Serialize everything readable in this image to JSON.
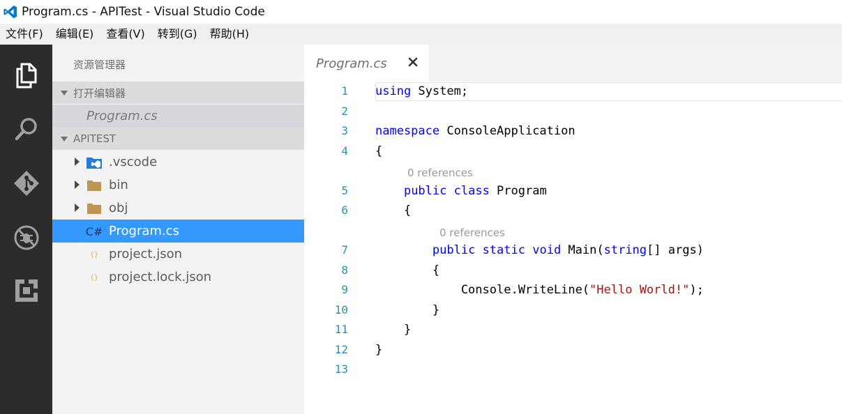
{
  "window": {
    "title": "Program.cs - APITest - Visual Studio Code",
    "logo_icon": "vscode-logo-icon",
    "accent_color": "#007acc"
  },
  "menu": [
    "文件(F)",
    "编辑(E)",
    "查看(V)",
    "转到(G)",
    "帮助(H)"
  ],
  "activity_bar": [
    {
      "name": "explorer-icon",
      "active": true
    },
    {
      "name": "search-icon",
      "active": false
    },
    {
      "name": "git-icon",
      "active": false
    },
    {
      "name": "debug-icon",
      "active": false
    },
    {
      "name": "extensions-icon",
      "active": false
    }
  ],
  "sidebar": {
    "title": "资源管理器",
    "open_editors": {
      "label": "打开编辑器",
      "files": [
        "Program.cs"
      ]
    },
    "project": {
      "label": "APITEST",
      "items": [
        {
          "name": ".vscode",
          "type": "folder",
          "icon": "vscode-folder-icon",
          "collapsed": true
        },
        {
          "name": "bin",
          "type": "folder",
          "icon": "folder-icon",
          "collapsed": true
        },
        {
          "name": "obj",
          "type": "folder",
          "icon": "folder-icon",
          "collapsed": true
        },
        {
          "name": "Program.cs",
          "type": "file",
          "icon": "csharp-file-icon",
          "icon_text": "C#",
          "selected": true
        },
        {
          "name": "project.json",
          "type": "file",
          "icon": "json-file-icon",
          "icon_text": "{}"
        },
        {
          "name": "project.lock.json",
          "type": "file",
          "icon": "json-file-icon",
          "icon_text": "{}"
        }
      ]
    }
  },
  "editor": {
    "tab": {
      "label": "Program.cs",
      "close_symbol": "✕"
    },
    "lines": [
      {
        "n": "1",
        "tokens": [
          {
            "t": "using",
            "c": "kw"
          },
          {
            "t": " System;",
            "c": ""
          }
        ]
      },
      {
        "n": "2",
        "tokens": []
      },
      {
        "n": "3",
        "tokens": [
          {
            "t": "namespace",
            "c": "kw"
          },
          {
            "t": " ConsoleApplication",
            "c": ""
          }
        ]
      },
      {
        "n": "4",
        "tokens": [
          {
            "t": "{",
            "c": ""
          }
        ]
      },
      {
        "lens": "0 references",
        "indent": 1
      },
      {
        "n": "5",
        "tokens": [
          {
            "t": "    ",
            "c": ""
          },
          {
            "t": "public",
            "c": "kw"
          },
          {
            "t": " ",
            "c": ""
          },
          {
            "t": "class",
            "c": "kw"
          },
          {
            "t": " Program",
            "c": ""
          }
        ]
      },
      {
        "n": "6",
        "tokens": [
          {
            "t": "    {",
            "c": ""
          }
        ]
      },
      {
        "lens": "0 references",
        "indent": 2
      },
      {
        "n": "7",
        "tokens": [
          {
            "t": "        ",
            "c": ""
          },
          {
            "t": "public",
            "c": "kw"
          },
          {
            "t": " ",
            "c": ""
          },
          {
            "t": "static",
            "c": "kw"
          },
          {
            "t": " ",
            "c": ""
          },
          {
            "t": "void",
            "c": "kw"
          },
          {
            "t": " Main(",
            "c": ""
          },
          {
            "t": "string",
            "c": "kw"
          },
          {
            "t": "[] args)",
            "c": ""
          }
        ]
      },
      {
        "n": "8",
        "tokens": [
          {
            "t": "        {",
            "c": ""
          }
        ]
      },
      {
        "n": "9",
        "tokens": [
          {
            "t": "            Console.WriteLine(",
            "c": ""
          },
          {
            "t": "\"Hello World!\"",
            "c": "str"
          },
          {
            "t": ");",
            "c": ""
          }
        ]
      },
      {
        "n": "10",
        "tokens": [
          {
            "t": "        }",
            "c": ""
          }
        ]
      },
      {
        "n": "11",
        "tokens": [
          {
            "t": "    }",
            "c": ""
          }
        ]
      },
      {
        "n": "12",
        "tokens": [
          {
            "t": "}",
            "c": ""
          }
        ]
      },
      {
        "n": "13",
        "tokens": []
      }
    ]
  },
  "colors": {
    "keyword": "#0000ff",
    "string": "#a31515",
    "line_number": "#2b91af",
    "selection": "#3399ff",
    "activity_bar": "#2c2c2c"
  }
}
